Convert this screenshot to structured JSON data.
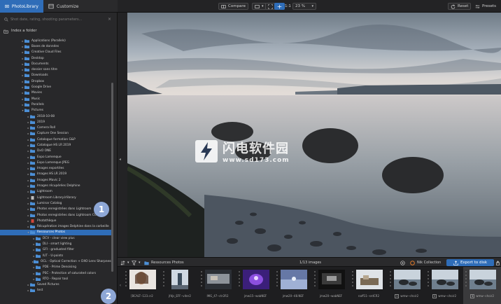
{
  "tabs": [
    {
      "label": "PhotoLibrary",
      "icon": "photo-library-icon",
      "active": true
    },
    {
      "label": "Customize",
      "icon": "customize-icon",
      "active": false
    }
  ],
  "toolbar": {
    "compare_label": "Compare",
    "view_label": "1:1",
    "zoom_label": "23 %",
    "reset_label": "Reset",
    "presets_label": "Presets"
  },
  "sidebar": {
    "search_placeholder": "Shot date, rating, shooting parameters...",
    "index_label": "Index a folder",
    "tree": [
      {
        "label": "Applications (Parallels)",
        "depth": 1,
        "open": false
      },
      {
        "label": "Bases de données",
        "depth": 1,
        "open": false
      },
      {
        "label": "Creative Cloud Files",
        "depth": 1,
        "open": false
      },
      {
        "label": "Desktop",
        "depth": 1,
        "open": false
      },
      {
        "label": "Documents",
        "depth": 1,
        "open": false
      },
      {
        "label": "dossier sans titre",
        "depth": 1,
        "open": false
      },
      {
        "label": "Downloads",
        "depth": 1,
        "open": false
      },
      {
        "label": "Dropbox",
        "depth": 1,
        "open": false
      },
      {
        "label": "Google Drive",
        "depth": 1,
        "open": false
      },
      {
        "label": "Movies",
        "depth": 1,
        "open": false
      },
      {
        "label": "Music",
        "depth": 1,
        "open": false
      },
      {
        "label": "Parallels",
        "depth": 1,
        "open": false
      },
      {
        "label": "Pictures",
        "depth": 1,
        "open": true
      },
      {
        "label": "2018-10-08",
        "depth": 2,
        "open": false
      },
      {
        "label": "2019",
        "depth": 2,
        "open": false
      },
      {
        "label": "Camera Roll",
        "depth": 2,
        "open": false
      },
      {
        "label": "Capture One Session",
        "depth": 2,
        "open": false
      },
      {
        "label": "Catalogue formation G&P",
        "depth": 2,
        "open": false
      },
      {
        "label": "Catalogue HS LR 2019",
        "depth": 2,
        "open": false
      },
      {
        "label": "DxO ONE",
        "depth": 2,
        "open": false
      },
      {
        "label": "Expo Lamenque",
        "depth": 2,
        "open": false
      },
      {
        "label": "Expo Lamenque JPEG",
        "depth": 2,
        "open": false
      },
      {
        "label": "Images exportées",
        "depth": 2,
        "open": false
      },
      {
        "label": "Images HS LR 2019",
        "depth": 2,
        "open": false
      },
      {
        "label": "Images Mavic 2",
        "depth": 2,
        "open": false
      },
      {
        "label": "Images récupérées Delphine",
        "depth": 2,
        "open": false
      },
      {
        "label": "Lightroom",
        "depth": 2,
        "open": false
      },
      {
        "label": "Lightroom Library.lrlibrary",
        "depth": 2,
        "open": false,
        "file": true
      },
      {
        "label": "Luminar Catalog",
        "depth": 2,
        "open": false
      },
      {
        "label": "Photos enregistrées dans Lightroom",
        "depth": 2,
        "open": false
      },
      {
        "label": "Photos enregistrées dans Lightroom CC",
        "depth": 2,
        "open": false
      },
      {
        "label": "Photothèque",
        "depth": 2,
        "open": false,
        "file": true,
        "red": true
      },
      {
        "label": "Récupération images Delphine dans la corbeille",
        "depth": 2,
        "open": false
      },
      {
        "label": "Ressources Photos",
        "depth": 2,
        "open": true,
        "selected": true
      },
      {
        "label": "DCV - clear view plus",
        "depth": 3,
        "open": false
      },
      {
        "label": "DLI - smart lighting",
        "depth": 3,
        "open": false
      },
      {
        "label": "GFI - graduated filter",
        "depth": 3,
        "open": false
      },
      {
        "label": "IUT - U-points",
        "depth": 3,
        "open": false
      },
      {
        "label": "OCL - Optical Correction + DXO Lens Sharpness",
        "depth": 3,
        "open": false
      },
      {
        "label": "PDE - Prime Denoising",
        "depth": 3,
        "open": false
      },
      {
        "label": "PSC - Protection of saturated colors",
        "depth": 3,
        "open": false
      },
      {
        "label": "RTO - Repair tool",
        "depth": 3,
        "open": false
      },
      {
        "label": "Saved Pictures",
        "depth": 2,
        "open": false
      },
      {
        "label": "test",
        "depth": 2,
        "open": false
      }
    ]
  },
  "badges": [
    "1",
    "2"
  ],
  "watermark": {
    "name": "闪电软件园",
    "url": "www.sd173.com"
  },
  "filmstrip_header": {
    "folder_label": "Ressources Photos",
    "count_label": "1/13 images",
    "nik_label": "Nik Collection",
    "export_label": "Export to disk"
  },
  "thumbnails": [
    {
      "caption": "[BCALT--123.cr2",
      "num": ""
    },
    {
      "caption": "jfdjs_EFF--viter2",
      "num": ""
    },
    {
      "caption": "IMG_47--ctr2R2",
      "num": ""
    },
    {
      "caption": "jmw15--wabNEF",
      "num": ""
    },
    {
      "caption": "jmw20--48.NEF",
      "num": ""
    },
    {
      "caption": "jmw20--wabNEF",
      "num": ""
    },
    {
      "caption": "naff11--srdCR2",
      "num": ""
    },
    {
      "caption": "wmw--choir2",
      "num": "1"
    },
    {
      "caption": "wmw--choir2",
      "num": "2"
    },
    {
      "caption": "wmw--choir2",
      "num": "3"
    }
  ],
  "colors": {
    "accent": "#2f6db8",
    "panel": "#28282a",
    "badge": "#8ea7d6"
  }
}
